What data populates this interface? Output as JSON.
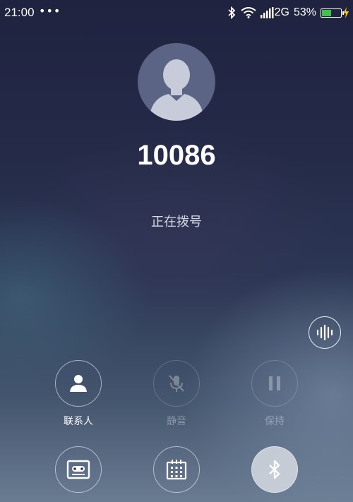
{
  "status_bar": {
    "time": "21:00",
    "dots": "•••",
    "network": "2G",
    "battery_percent": "53%",
    "battery_level": 0.53,
    "icons": [
      "bluetooth-icon",
      "wifi-icon",
      "signal-icon",
      "battery-icon",
      "charging-icon"
    ]
  },
  "call": {
    "number": "10086",
    "status": "正在拨号"
  },
  "controls": {
    "contacts": {
      "label": "联系人",
      "icon": "contact-icon",
      "enabled": true
    },
    "mute": {
      "label": "静音",
      "icon": "mic-off-icon",
      "enabled": false
    },
    "hold": {
      "label": "保持",
      "icon": "pause-icon",
      "enabled": false
    },
    "record": {
      "icon": "record-icon"
    },
    "keypad": {
      "icon": "keypad-icon"
    },
    "bluetooth": {
      "icon": "bluetooth-icon",
      "active": true
    }
  },
  "voice_button": {
    "icon": "voice-wave-icon"
  },
  "colors": {
    "battery_fill": "#40c24a",
    "charging": "#f5c518",
    "avatar_bg": "#5b6485",
    "avatar_silhouette": "#c8ccda"
  }
}
